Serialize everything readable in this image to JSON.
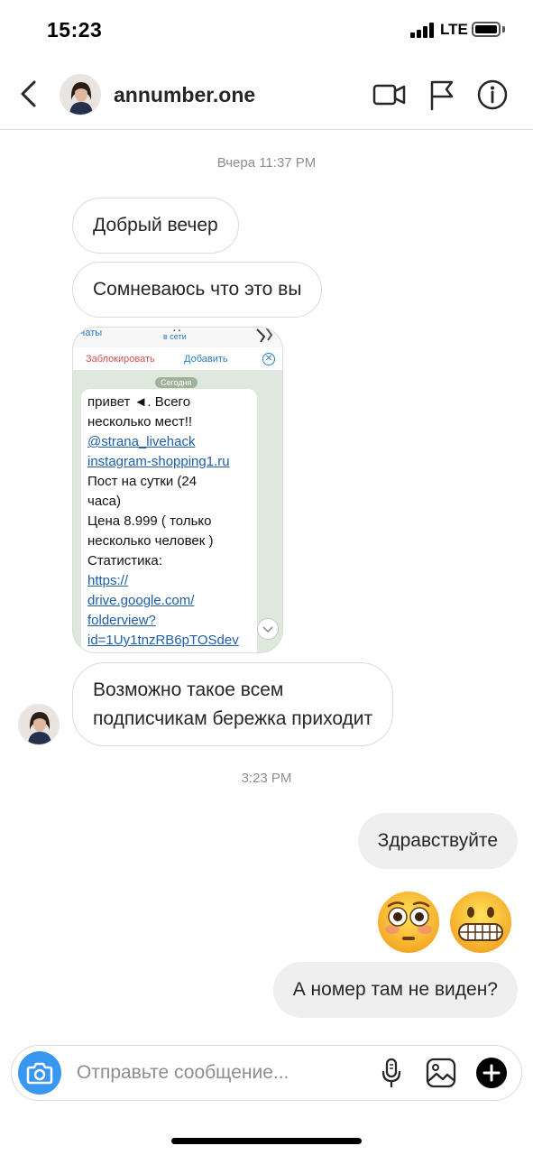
{
  "status_bar": {
    "time": "15:23",
    "network": "LTE"
  },
  "header": {
    "username": "annumber.one",
    "icons": [
      "back-icon",
      "video-call-icon",
      "flag-icon",
      "info-icon"
    ]
  },
  "messages": {
    "timestamp_1": "Вчера 11:37 PM",
    "in_1": "Добрый вечер",
    "in_2": "Сомневаюсь что это вы",
    "in_3_line1": "Возможно такое всем",
    "in_3_line2": "подписчикам бережка приходит",
    "timestamp_2": "3:23 PM",
    "out_1": "Здравствуйте",
    "out_emoji": [
      "flushed-face-emoji",
      "grimacing-face-emoji"
    ],
    "out_2": "А номер там не виден?"
  },
  "shared_screenshot": {
    "chats_label": "Чаты",
    "online_label": "в сети",
    "block_label": "Заблокировать",
    "add_label": "Добавить",
    "close_symbol": "✕",
    "date_label": "Сегодня",
    "lines": [
      {
        "text": "привет ◄. Всего",
        "link": false
      },
      {
        "text": "несколько мест!!",
        "link": false
      },
      {
        "text": "@strana_livehack",
        "link": true
      },
      {
        "text": "instagram-shopping1.ru",
        "link": true
      },
      {
        "text": "Пост на сутки (24",
        "link": false
      },
      {
        "text": "часа)",
        "link": false
      },
      {
        "text": "Цена 8.999 ( только",
        "link": false
      },
      {
        "text": "несколько человек )",
        "link": false
      },
      {
        "text": "Статистика:",
        "link": false
      },
      {
        "text": "https://",
        "link": true
      },
      {
        "text": "drive.google.com/",
        "link": true
      },
      {
        "text": "folderview?",
        "link": true
      },
      {
        "text": "id=1Uy1tnzRB6pTOSdev",
        "link": true
      }
    ]
  },
  "composer": {
    "placeholder": "Отправьте сообщение..."
  },
  "colors": {
    "accent_blue": "#3897f0",
    "outgoing_bubble": "#efefef",
    "border": "#dbdbdb",
    "muted_text": "#8e8e8e",
    "link_blue": "#1f5ea8"
  }
}
